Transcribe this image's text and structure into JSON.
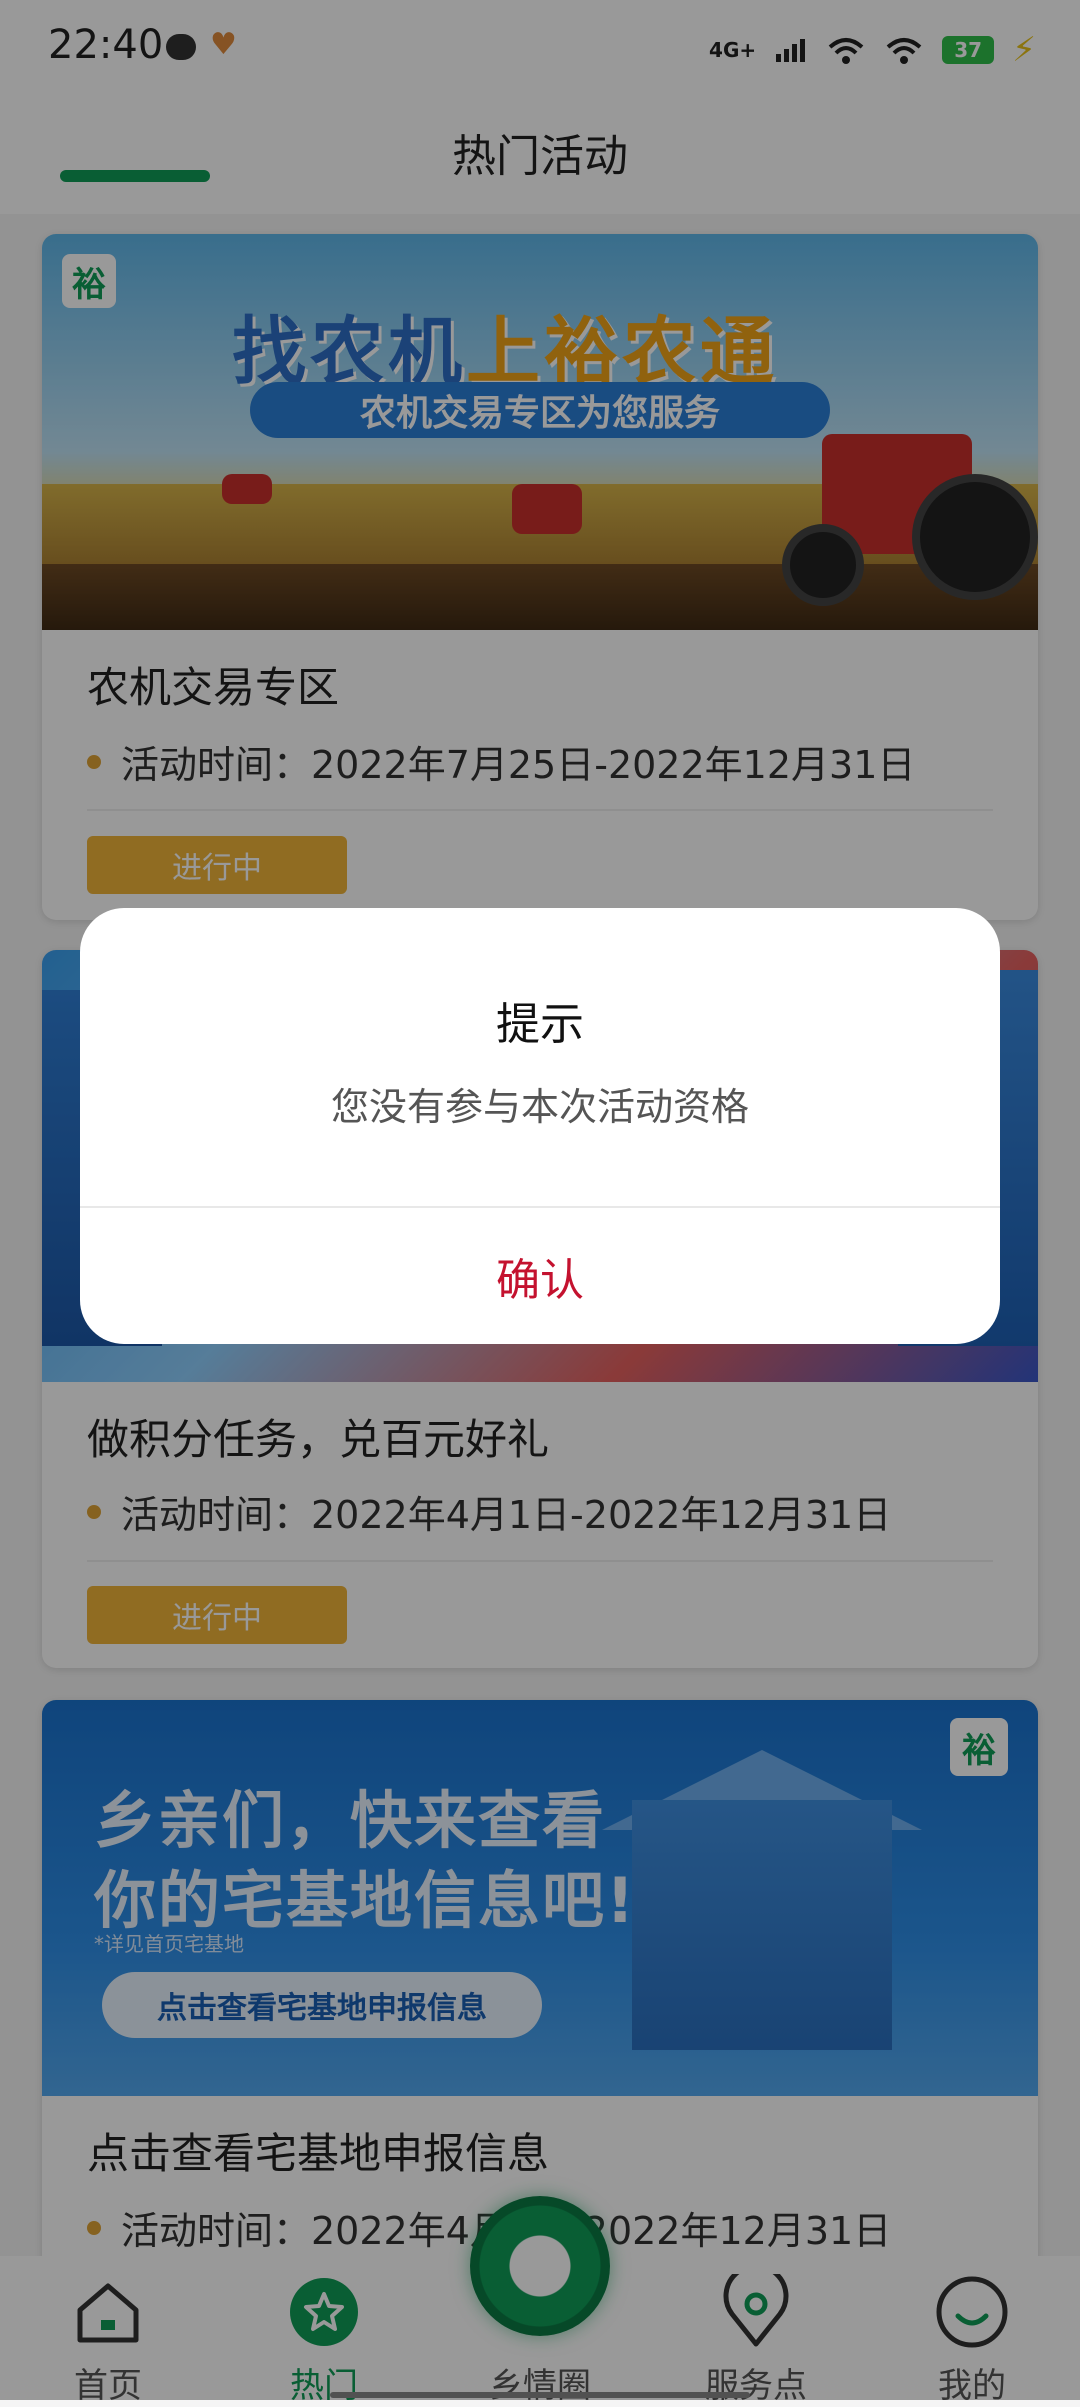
{
  "status_bar": {
    "time": "22:40",
    "network": "4G+",
    "battery": "37"
  },
  "header": {
    "title": "热门活动"
  },
  "cards": [
    {
      "banner": {
        "logo": "裕",
        "headline_prefix": "找农机",
        "headline_highlight": "上裕农通",
        "pill_text": "农机交易专区为您服务"
      },
      "title": "农机交易专区",
      "time_text": "活动时间：2022年7月25日-2022年12月31日",
      "status": "进行中"
    },
    {
      "title": "做积分任务，兑百元好礼",
      "time_text": "活动时间：2022年4月1日-2022年12月31日",
      "status": "进行中"
    },
    {
      "banner": {
        "logo": "裕",
        "line1": "乡亲们，快来查看",
        "line2": "你的宅基地信息吧!",
        "note": "*详见首页宅基地",
        "button": "点击查看宅基地申报信息"
      },
      "title": "点击查看宅基地申报信息",
      "time_text": "活动时间：2022年4月1日-2022年12月31日"
    }
  ],
  "dialog": {
    "title": "提示",
    "message": "您没有参与本次活动资格",
    "confirm": "确认"
  },
  "bottom_nav": {
    "items": [
      {
        "label": "首页",
        "icon": "home-icon"
      },
      {
        "label": "热门",
        "icon": "hot-icon",
        "active": true
      },
      {
        "label": "乡情圈",
        "icon": "circle-icon"
      },
      {
        "label": "服务点",
        "icon": "location-pin-icon"
      },
      {
        "label": "我的",
        "icon": "profile-smile-icon"
      }
    ]
  },
  "colors": {
    "brand_green": "#0f9d58",
    "tag_orange": "#f0b43a",
    "confirm_red": "#c4122f"
  }
}
